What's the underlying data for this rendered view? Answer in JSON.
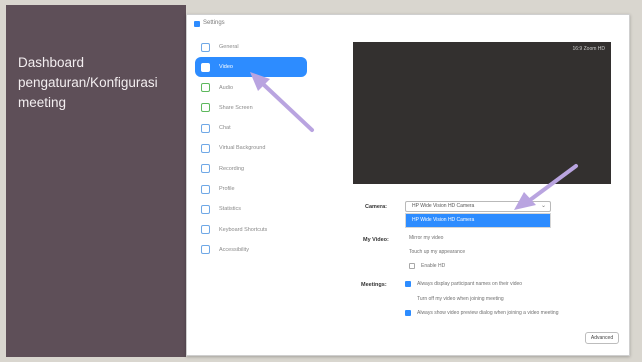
{
  "caption": {
    "line1": "Dashboard",
    "line2": "pengaturan/Konfigurasi",
    "line3": "meeting"
  },
  "window": {
    "title": "Settings"
  },
  "sidebar": {
    "items": [
      {
        "label": "General",
        "icon": "gear-icon"
      },
      {
        "label": "Video",
        "icon": "video-camera-icon",
        "active": true
      },
      {
        "label": "Audio",
        "icon": "headphones-icon"
      },
      {
        "label": "Share Screen",
        "icon": "share-screen-icon"
      },
      {
        "label": "Chat",
        "icon": "chat-icon"
      },
      {
        "label": "Virtual Background",
        "icon": "virtual-background-icon"
      },
      {
        "label": "Recording",
        "icon": "recording-icon"
      },
      {
        "label": "Profile",
        "icon": "profile-icon"
      },
      {
        "label": "Statistics",
        "icon": "statistics-icon"
      },
      {
        "label": "Keyboard Shortcuts",
        "icon": "keyboard-icon"
      },
      {
        "label": "Accessibility",
        "icon": "accessibility-icon"
      }
    ]
  },
  "video": {
    "preview_label": "16:9 Zoom HD",
    "camera_label": "Camera:",
    "camera_value": "HP Wide Vision HD Camera",
    "dropdown_option": "HP Wide Vision HD Camera",
    "my_video_label": "My Video:",
    "my_video_options": [
      {
        "label": "Mirror my video",
        "checked": false
      },
      {
        "label": "Touch up my appearance",
        "checked": false
      },
      {
        "label": "Enable HD",
        "checked": false
      }
    ],
    "meetings_label": "Meetings:",
    "meetings_options": [
      {
        "label": "Always display participant names on their video",
        "checked": true
      },
      {
        "label": "Turn off my video when joining meeting",
        "checked": false
      },
      {
        "label": "Always show video preview dialog when joining a video meeting",
        "checked": true
      }
    ],
    "advanced_label": "Advanced"
  },
  "colors": {
    "accent": "#2d8cff",
    "arrow": "#b9a4e0",
    "panel": "#5e4f58"
  }
}
